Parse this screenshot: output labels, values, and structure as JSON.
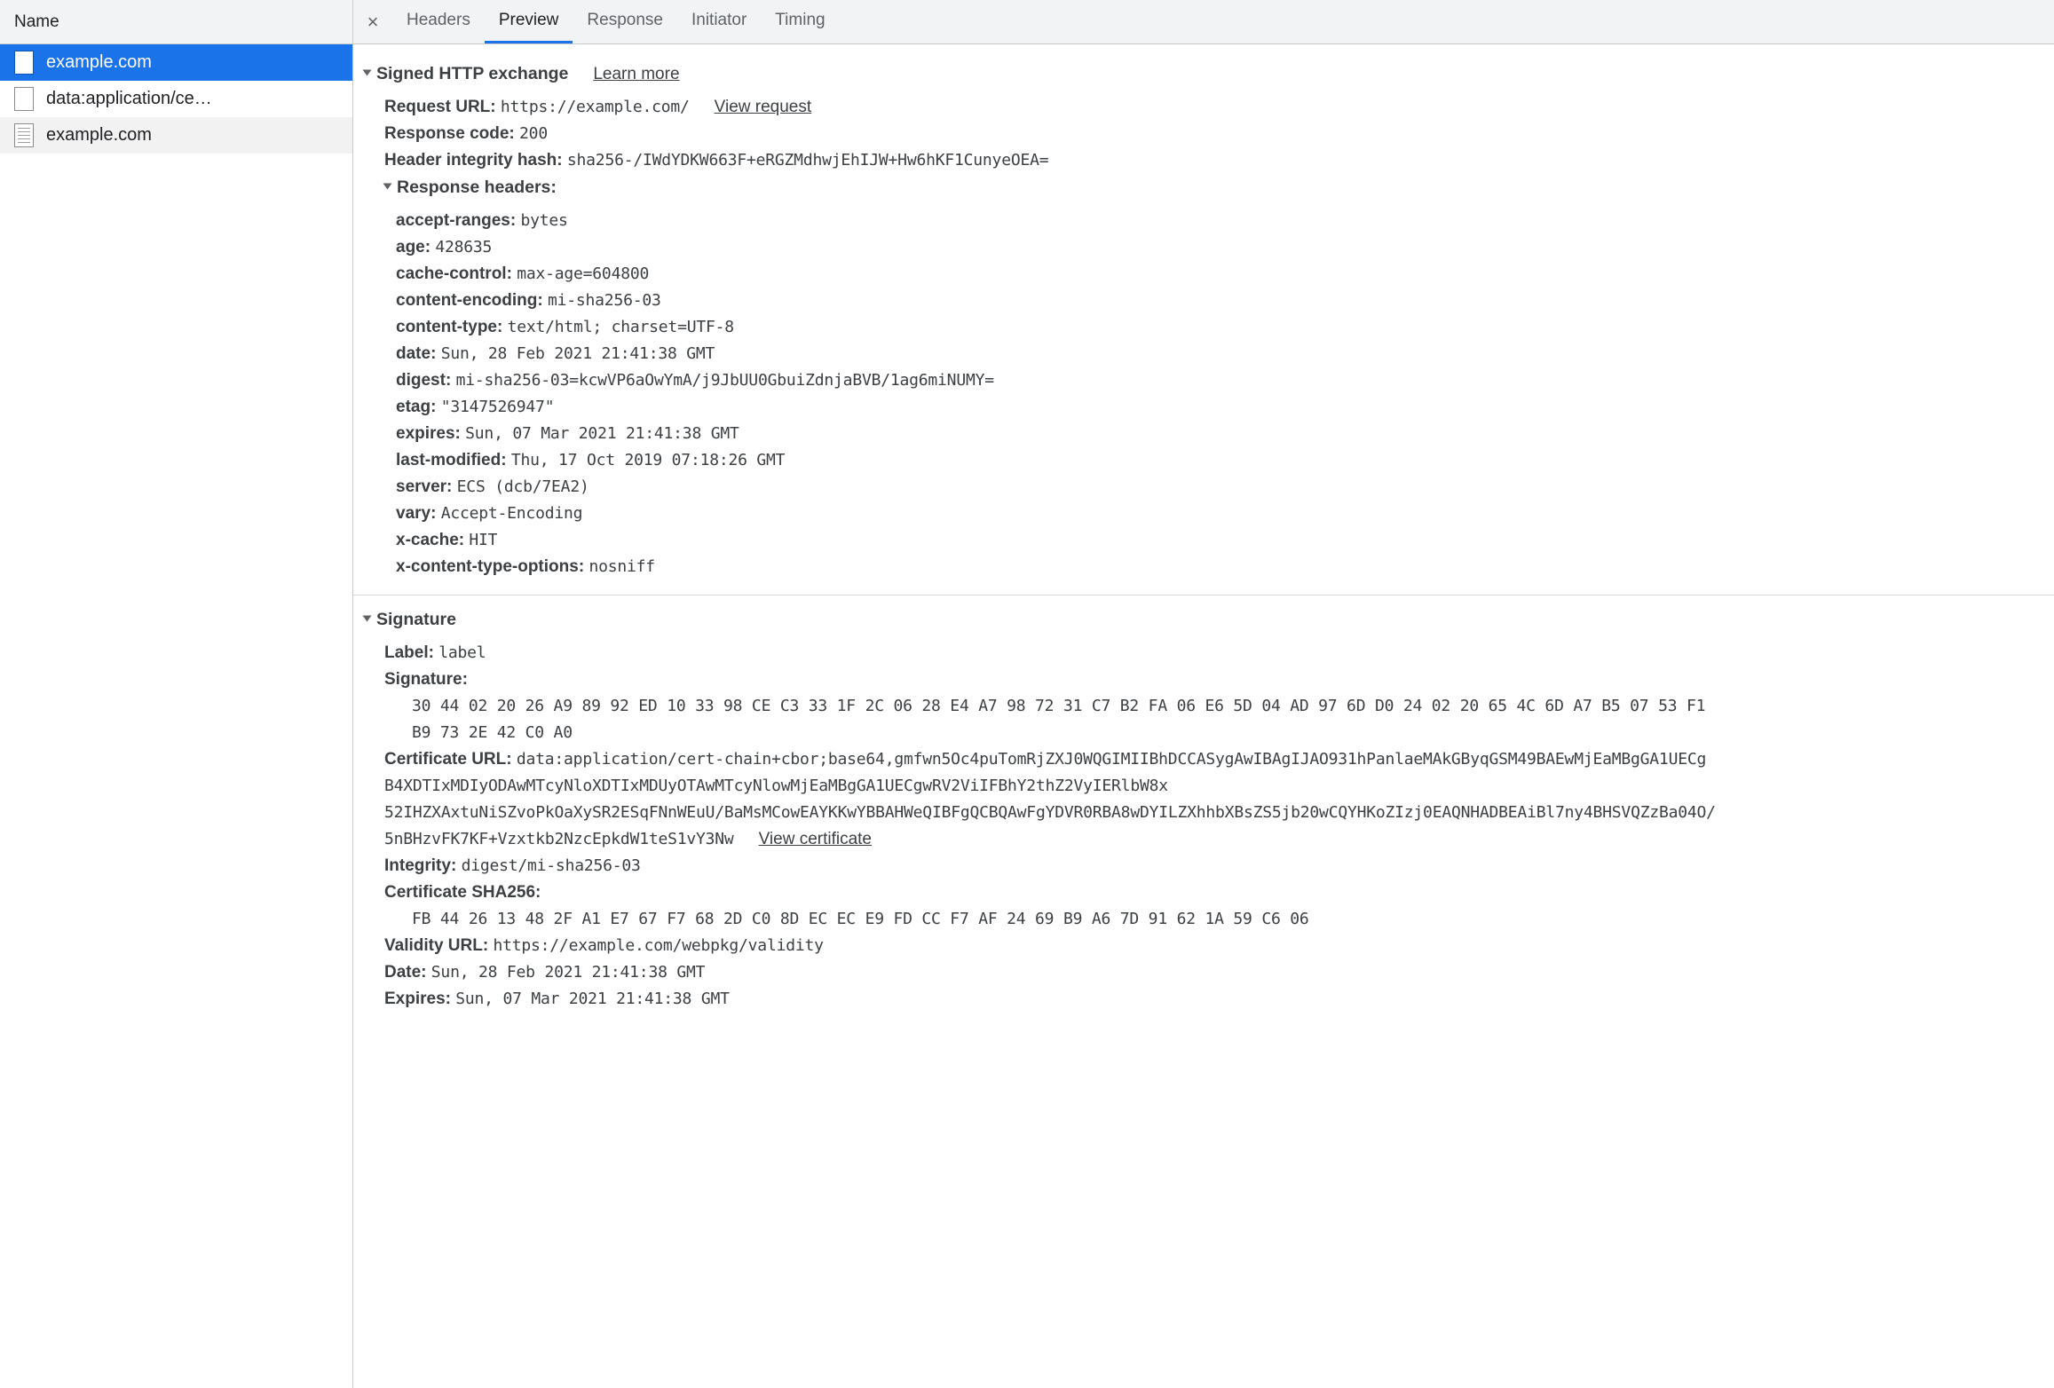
{
  "sidebar": {
    "column_header": "Name",
    "rows": [
      {
        "label": "example.com",
        "icon": "page-icon",
        "selected": true
      },
      {
        "label": "data:application/ce…",
        "icon": "page-icon",
        "selected": false
      },
      {
        "label": "example.com",
        "icon": "document-icon",
        "selected": false
      }
    ]
  },
  "tabbar": {
    "close_label": "×",
    "tabs": [
      {
        "label": "Headers",
        "active": false
      },
      {
        "label": "Preview",
        "active": true
      },
      {
        "label": "Response",
        "active": false
      },
      {
        "label": "Initiator",
        "active": false
      },
      {
        "label": "Timing",
        "active": false
      }
    ]
  },
  "preview": {
    "sxg_section": {
      "title": "Signed HTTP exchange",
      "learn_more": "Learn more",
      "request_url_label": "Request URL:",
      "request_url_value": "https://example.com/",
      "view_request_link": "View request",
      "response_code_label": "Response code:",
      "response_code_value": "200",
      "header_integrity_label": "Header integrity hash:",
      "header_integrity_value": "sha256-/IWdYDKW663F+eRGZMdhwjEhIJW+Hw6hKF1CunyeOEA=",
      "response_headers_title": "Response headers:",
      "response_headers": [
        {
          "name": "accept-ranges:",
          "value": "bytes"
        },
        {
          "name": "age:",
          "value": "428635"
        },
        {
          "name": "cache-control:",
          "value": "max-age=604800"
        },
        {
          "name": "content-encoding:",
          "value": "mi-sha256-03"
        },
        {
          "name": "content-type:",
          "value": "text/html; charset=UTF-8"
        },
        {
          "name": "date:",
          "value": "Sun, 28 Feb 2021 21:41:38 GMT"
        },
        {
          "name": "digest:",
          "value": "mi-sha256-03=kcwVP6aOwYmA/j9JbUU0GbuiZdnjaBVB/1ag6miNUMY="
        },
        {
          "name": "etag:",
          "value": "\"3147526947\""
        },
        {
          "name": "expires:",
          "value": "Sun, 07 Mar 2021 21:41:38 GMT"
        },
        {
          "name": "last-modified:",
          "value": "Thu, 17 Oct 2019 07:18:26 GMT"
        },
        {
          "name": "server:",
          "value": "ECS (dcb/7EA2)"
        },
        {
          "name": "vary:",
          "value": "Accept-Encoding"
        },
        {
          "name": "x-cache:",
          "value": "HIT"
        },
        {
          "name": "x-content-type-options:",
          "value": "nosniff"
        }
      ]
    },
    "signature_section": {
      "title": "Signature",
      "label_label": "Label:",
      "label_value": "label",
      "signature_label": "Signature:",
      "signature_bytes_line1": "30 44 02 20 26 A9 89 92 ED 10 33 98 CE C3 33 1F 2C 06 28 E4 A7 98 72 31 C7 B2 FA 06 E6 5D 04 AD 97 6D D0 24 02 20 65 4C 6D A7 B5 07 53 F1",
      "signature_bytes_line2": "B9 73 2E 42 C0 A0",
      "certificate_url_label": "Certificate URL:",
      "certificate_url_line1": "data:application/cert-chain+cbor;base64,gmfwn5Oc4puTomRjZXJ0WQGIMIIBhDCCASygAwIBAgIJAO931hPanlaeMAkGByqGSM49BAEwMjEaMBgGA1UECg",
      "certificate_url_line2": "B4XDTIxMDIyODAwMTcyNloXDTIxMDUyOTAwMTcyNlowMjEaMBgGA1UECgwRV2ViIFBhY2thZ2VyIERlbW8x",
      "certificate_url_line3": "52IHZXAxtuNiSZvoPkOaXySR2ESqFNnWEuU/BaMsMCowEAYKKwYBBAHWeQIBFgQCBQAwFgYDVR0RBA8wDYILZXhhbXBsZS5jb20wCQYHKoZIzj0EAQNHADBEAiBl7ny4BHSVQZzBa04O/",
      "certificate_url_line4": "5nBHzvFK7KF+Vzxtkb2NzcEpkdW1teS1vY3Nw",
      "view_certificate_link": "View certificate",
      "integrity_label": "Integrity:",
      "integrity_value": "digest/mi-sha256-03",
      "certificate_sha256_label": "Certificate SHA256:",
      "certificate_sha256_value": "FB 44 26 13 48 2F A1 E7 67 F7 68 2D C0 8D EC EC E9 FD CC F7 AF 24 69 B9 A6 7D 91 62 1A 59 C6 06",
      "validity_url_label": "Validity URL:",
      "validity_url_value": "https://example.com/webpkg/validity",
      "date_label": "Date:",
      "date_value": "Sun, 28 Feb 2021 21:41:38 GMT",
      "expires_label": "Expires:",
      "expires_value": "Sun, 07 Mar 2021 21:41:38 GMT"
    }
  },
  "colors": {
    "accent": "#1a73e8",
    "panel_bg": "#f1f3f4",
    "text": "#3c4043"
  }
}
